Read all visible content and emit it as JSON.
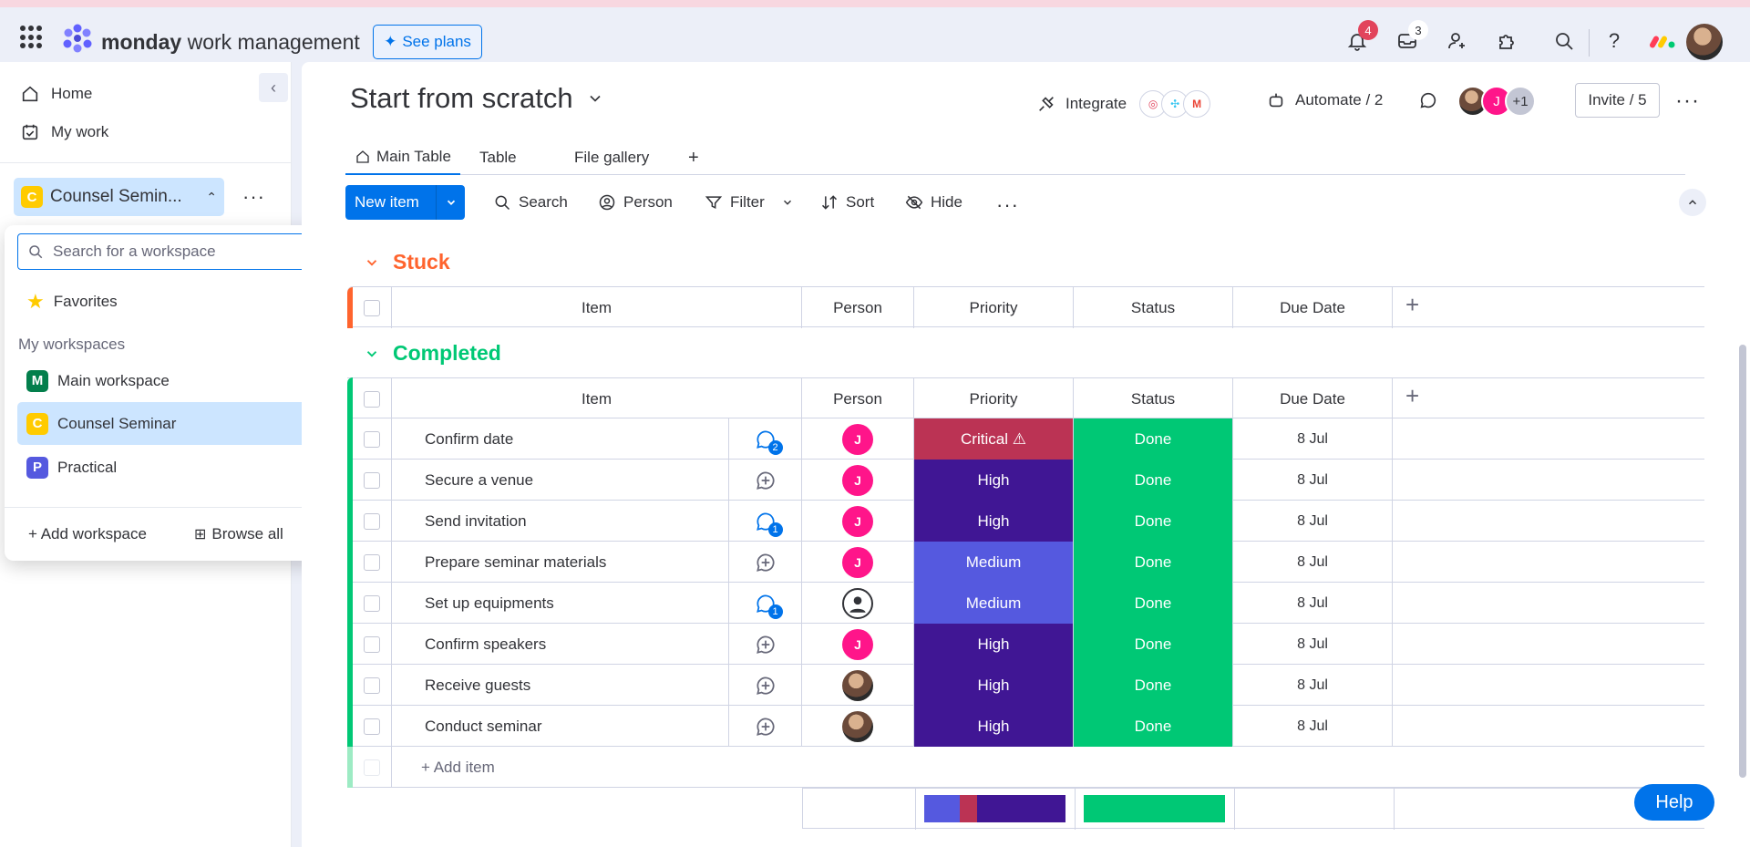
{
  "brand": {
    "bold": "monday",
    "light": " work management"
  },
  "header": {
    "see_plans": "See plans",
    "notifications_count": "4",
    "inbox_count": "3"
  },
  "sidebar": {
    "home": "Home",
    "my_work": "My work",
    "workspace_name": "Counsel Semin...",
    "workspace_letter": "C"
  },
  "workspace_dropdown": {
    "search_placeholder": "Search for a workspace",
    "favorites": "Favorites",
    "my_workspaces_label": "My workspaces",
    "workspaces": [
      {
        "letter": "M",
        "name": "Main workspace",
        "color": "#037f4c"
      },
      {
        "letter": "C",
        "name": "Counsel Seminar",
        "color": "#ffcb00"
      },
      {
        "letter": "P",
        "name": "Practical",
        "color": "#5559df"
      }
    ],
    "add_workspace": "+ Add workspace",
    "browse_all": "Browse all"
  },
  "board": {
    "title": "Start from scratch",
    "integrate": "Integrate",
    "automate": "Automate / 2",
    "avatar_j": "J",
    "avatar_more": "+1",
    "invite": "Invite / 5",
    "tabs": [
      "Main Table",
      "Table",
      "File gallery"
    ],
    "add_tab": "+"
  },
  "toolbar": {
    "new_item": "New item",
    "search": "Search",
    "person": "Person",
    "filter": "Filter",
    "sort": "Sort",
    "hide": "Hide"
  },
  "columns": {
    "item": "Item",
    "person": "Person",
    "priority": "Priority",
    "status": "Status",
    "due_date": "Due Date"
  },
  "groups": {
    "stuck": {
      "title": "Stuck",
      "color": "#ff642e"
    },
    "completed": {
      "title": "Completed",
      "color": "#00c875"
    }
  },
  "rows": [
    {
      "item": "Confirm date",
      "updates": "2",
      "person": "J",
      "priority": "Critical ⚠",
      "status": "Done",
      "date": "8 Jul"
    },
    {
      "item": "Secure a venue",
      "updates": "",
      "person": "J",
      "priority": "High",
      "status": "Done",
      "date": "8 Jul"
    },
    {
      "item": "Send invitation",
      "updates": "1",
      "person": "J",
      "priority": "High",
      "status": "Done",
      "date": "8 Jul"
    },
    {
      "item": "Prepare seminar materials",
      "updates": "",
      "person": "J",
      "priority": "Medium",
      "status": "Done",
      "date": "8 Jul"
    },
    {
      "item": "Set up equipments",
      "updates": "1",
      "person": "",
      "priority": "Medium",
      "status": "Done",
      "date": "8 Jul"
    },
    {
      "item": "Confirm speakers",
      "updates": "",
      "person": "J",
      "priority": "High",
      "status": "Done",
      "date": "8 Jul"
    },
    {
      "item": "Receive guests",
      "updates": "",
      "person": "",
      "priority": "High",
      "status": "Done",
      "date": "8 Jul"
    },
    {
      "item": "Conduct seminar",
      "updates": "",
      "person": "",
      "priority": "High",
      "status": "Done",
      "date": "8 Jul"
    }
  ],
  "add_item": "+ Add item",
  "help": "Help",
  "colors": {
    "critical": "#bb3354",
    "high": "#401694",
    "medium": "#5559df",
    "done": "#00c875",
    "person_j": "#ff158a"
  }
}
